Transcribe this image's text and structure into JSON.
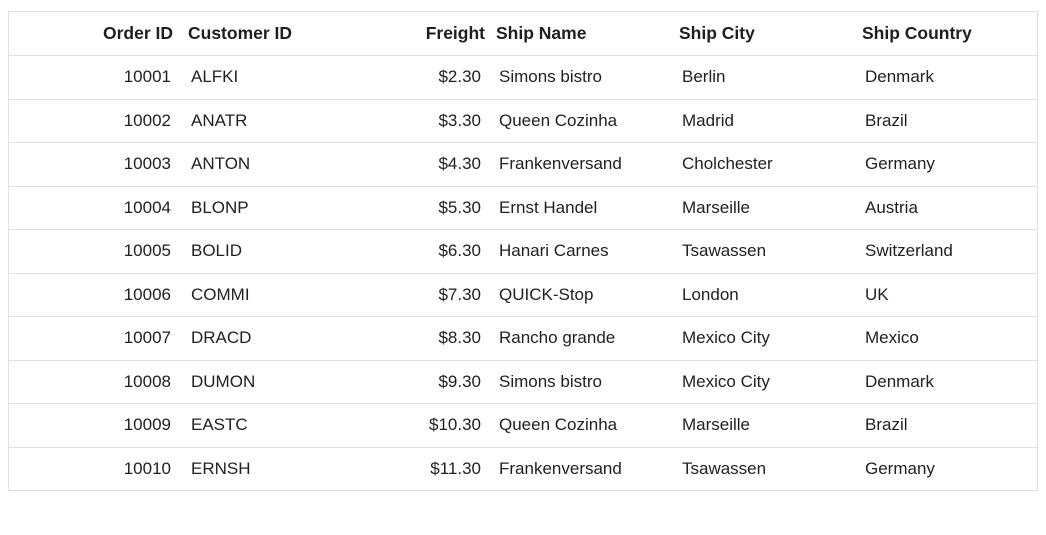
{
  "columns": {
    "order_id": "Order ID",
    "customer_id": "Customer ID",
    "freight": "Freight",
    "ship_name": "Ship Name",
    "ship_city": "Ship City",
    "ship_country": "Ship Country"
  },
  "rows": [
    {
      "order_id": "10001",
      "customer_id": "ALFKI",
      "freight": "$2.30",
      "ship_name": "Simons bistro",
      "ship_city": "Berlin",
      "ship_country": "Denmark"
    },
    {
      "order_id": "10002",
      "customer_id": "ANATR",
      "freight": "$3.30",
      "ship_name": "Queen Cozinha",
      "ship_city": "Madrid",
      "ship_country": "Brazil"
    },
    {
      "order_id": "10003",
      "customer_id": "ANTON",
      "freight": "$4.30",
      "ship_name": "Frankenversand",
      "ship_city": "Cholchester",
      "ship_country": "Germany"
    },
    {
      "order_id": "10004",
      "customer_id": "BLONP",
      "freight": "$5.30",
      "ship_name": "Ernst Handel",
      "ship_city": "Marseille",
      "ship_country": "Austria"
    },
    {
      "order_id": "10005",
      "customer_id": "BOLID",
      "freight": "$6.30",
      "ship_name": "Hanari Carnes",
      "ship_city": "Tsawassen",
      "ship_country": "Switzerland"
    },
    {
      "order_id": "10006",
      "customer_id": "COMMI",
      "freight": "$7.30",
      "ship_name": "QUICK-Stop",
      "ship_city": "London",
      "ship_country": "UK"
    },
    {
      "order_id": "10007",
      "customer_id": "DRACD",
      "freight": "$8.30",
      "ship_name": "Rancho grande",
      "ship_city": "Mexico City",
      "ship_country": "Mexico"
    },
    {
      "order_id": "10008",
      "customer_id": "DUMON",
      "freight": "$9.30",
      "ship_name": "Simons bistro",
      "ship_city": "Mexico City",
      "ship_country": "Denmark"
    },
    {
      "order_id": "10009",
      "customer_id": "EASTC",
      "freight": "$10.30",
      "ship_name": "Queen Cozinha",
      "ship_city": "Marseille",
      "ship_country": "Brazil"
    },
    {
      "order_id": "10010",
      "customer_id": "ERNSH",
      "freight": "$11.30",
      "ship_name": "Frankenversand",
      "ship_city": "Tsawassen",
      "ship_country": "Germany"
    }
  ]
}
